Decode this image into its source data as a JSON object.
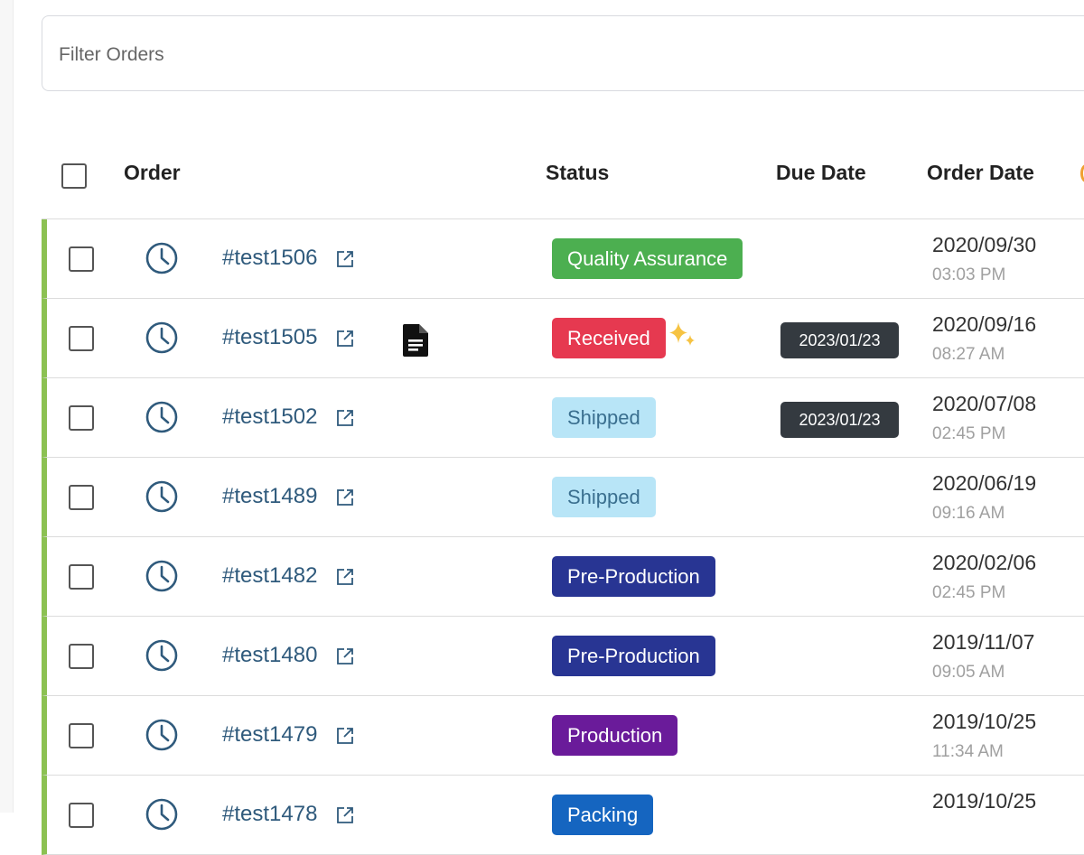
{
  "filter": {
    "placeholder": "Filter Orders"
  },
  "columns": {
    "order": "Order",
    "status": "Status",
    "due_date": "Due Date",
    "order_date": "Order Date"
  },
  "colors": {
    "quality_assurance": "#4caf50",
    "received": "#e63950",
    "shipped": "#b8e5f7",
    "pre_production": "#283593",
    "production": "#6a1b9a",
    "packing": "#1565c0",
    "row_accent": "#8cc152",
    "order_link": "#2f5a7c",
    "due_badge": "#343a40"
  },
  "rows": [
    {
      "order": "#test1506",
      "status": "Quality Assurance",
      "status_key": "quality_assurance",
      "due_date": "",
      "order_date": "2020/09/30",
      "order_time": "03:03 PM",
      "has_doc": false,
      "sparkle": false
    },
    {
      "order": "#test1505",
      "status": "Received",
      "status_key": "received",
      "due_date": "2023/01/23",
      "order_date": "2020/09/16",
      "order_time": "08:27 AM",
      "has_doc": true,
      "sparkle": true
    },
    {
      "order": "#test1502",
      "status": "Shipped",
      "status_key": "shipped",
      "due_date": "2023/01/23",
      "order_date": "2020/07/08",
      "order_time": "02:45 PM",
      "has_doc": false,
      "sparkle": false
    },
    {
      "order": "#test1489",
      "status": "Shipped",
      "status_key": "shipped",
      "due_date": "",
      "order_date": "2020/06/19",
      "order_time": "09:16 AM",
      "has_doc": false,
      "sparkle": false
    },
    {
      "order": "#test1482",
      "status": "Pre-Production",
      "status_key": "pre_production",
      "due_date": "",
      "order_date": "2020/02/06",
      "order_time": "02:45 PM",
      "has_doc": false,
      "sparkle": false
    },
    {
      "order": "#test1480",
      "status": "Pre-Production",
      "status_key": "pre_production",
      "due_date": "",
      "order_date": "2019/11/07",
      "order_time": "09:05 AM",
      "has_doc": false,
      "sparkle": false
    },
    {
      "order": "#test1479",
      "status": "Production",
      "status_key": "production",
      "due_date": "",
      "order_date": "2019/10/25",
      "order_time": "11:34 AM",
      "has_doc": false,
      "sparkle": false
    },
    {
      "order": "#test1478",
      "status": "Packing",
      "status_key": "packing",
      "due_date": "",
      "order_date": "2019/10/25",
      "order_time": "",
      "has_doc": false,
      "sparkle": false
    }
  ]
}
